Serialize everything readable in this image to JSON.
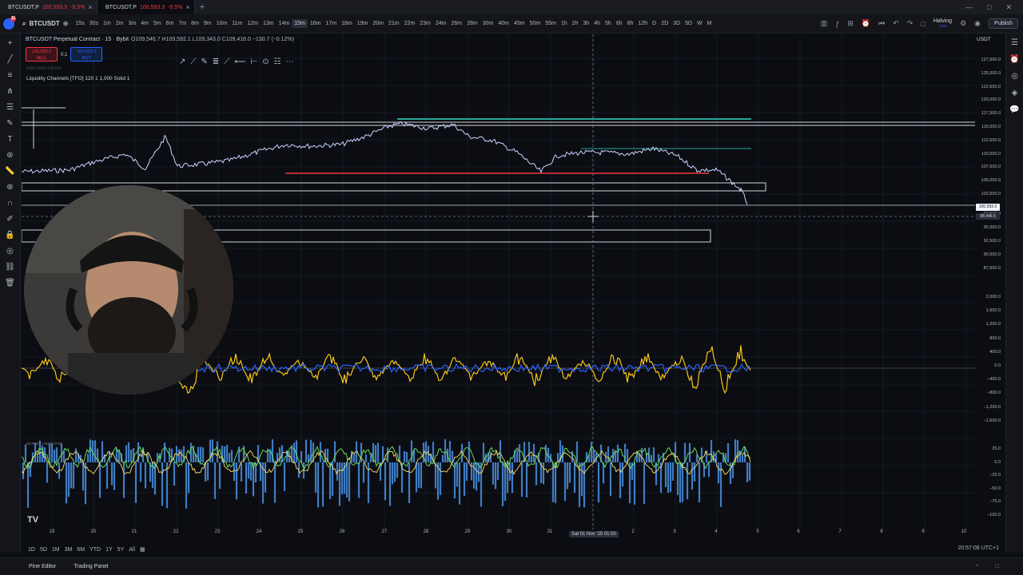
{
  "tabs": [
    {
      "symbol": "BTCUSDT.P",
      "price": "100,593.3",
      "change": "-5.5%"
    },
    {
      "symbol": "BTCUSDT.P",
      "price": "100,593.3",
      "change": "-5.5%"
    }
  ],
  "toolbar": {
    "symbol": "BTCUSDT",
    "timeframes": [
      "15s",
      "30s",
      "1m",
      "2m",
      "3m",
      "4m",
      "5m",
      "6m",
      "7m",
      "8m",
      "9m",
      "10m",
      "11m",
      "12m",
      "13m",
      "14m",
      "15m",
      "16m",
      "17m",
      "18m",
      "19m",
      "20m",
      "21m",
      "22m",
      "23m",
      "24m",
      "26m",
      "28m",
      "30m",
      "40m",
      "45m",
      "50m",
      "55m",
      "1h",
      "2h",
      "3h",
      "4h",
      "5h",
      "6h",
      "8h",
      "12h",
      "D",
      "2D",
      "3D",
      "5D",
      "W",
      "M"
    ],
    "selected_timeframe": "15m",
    "halving_label": "Halving",
    "halving_sub": "Live",
    "publish_label": "Publish",
    "notif_count": "11"
  },
  "legend": {
    "title": "BTCUSDT Perpetual Contract · 15 · Bybit",
    "ohlc": "O109,546.7 H109,592.1 L109,343.0 C109,416.0 −130.7 (−0.12%)",
    "sell_price": "100,593.2",
    "sell_label": "SELL",
    "qty": "0.1",
    "buy_price": "100,593.3",
    "buy_label": "BUY",
    "ema": "EMA 20/50/100/200",
    "indicator": "Liquidity Channels [TFO] 120 1 1,000 Solid 1",
    "currency": "USDT"
  },
  "price_axis": [
    "127,500.0",
    "125,000.0",
    "122,500.0",
    "120,000.0",
    "117,500.0",
    "115,000.0",
    "112,500.0",
    "110,000.0",
    "107,500.0",
    "105,000.0",
    "102,500.0",
    "97,500.0",
    "95,000.0",
    "92,500.0",
    "90,000.0",
    "87,500.0"
  ],
  "current_price": "100,593.3",
  "crosshair_price": "98,446.5",
  "osc1_axis": [
    "2,000.0",
    "1,600.0",
    "1,200.0",
    "800.0",
    "400.0",
    "0.0",
    "−400.0",
    "−800.0",
    "−1,200.0",
    "−1,600.0"
  ],
  "osc2_axis": [
    "25.0",
    "0.0",
    "−25.0",
    "−50.0",
    "−75.0",
    "−100.0"
  ],
  "osc2_label": "MARKET LIBERATOR",
  "time_axis": [
    "19",
    "20",
    "21",
    "22",
    "23",
    "24",
    "25",
    "26",
    "27",
    "28",
    "29",
    "30",
    "31",
    "2",
    "3",
    "4",
    "5",
    "6",
    "7",
    "8",
    "9",
    "10"
  ],
  "crosshair_time": "Sat 01 Nov '25  01:00",
  "ranges": [
    "1D",
    "5D",
    "1M",
    "3M",
    "6M",
    "YTD",
    "1Y",
    "5Y",
    "All"
  ],
  "clock": "20:57:08 UTC+1",
  "bottom": {
    "pine": "Pine Editor",
    "trading": "Trading Panel"
  },
  "colors": {
    "bg": "#0b0d12",
    "price_line": "#c9d4ff",
    "support": "#f23645",
    "resistance": "#26a69a",
    "osc": "#f5c518",
    "blue": "#2962ff"
  }
}
